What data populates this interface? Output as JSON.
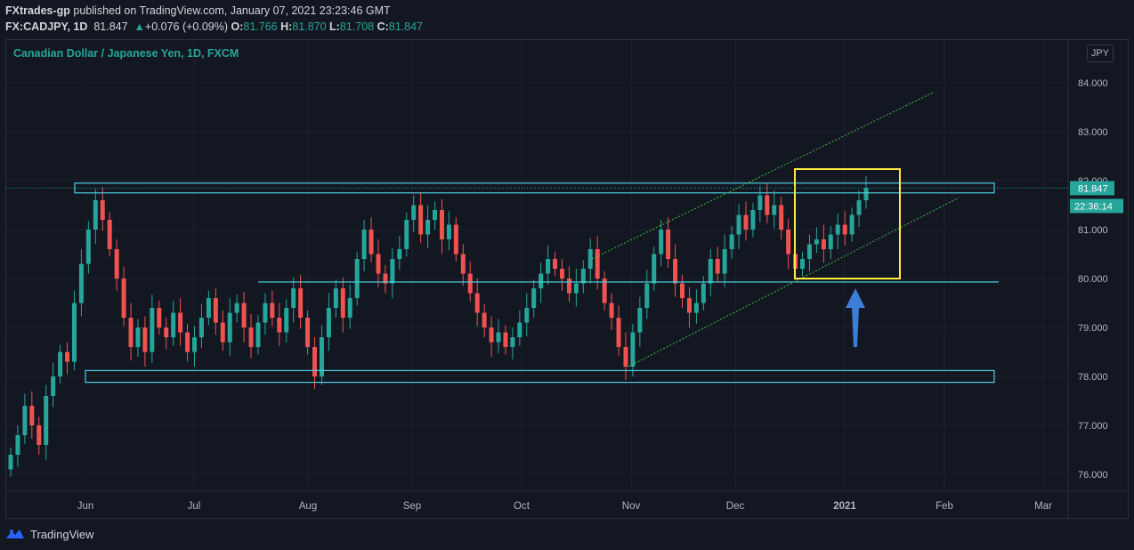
{
  "header": {
    "author": "FXtrades-gp",
    "published_text": "published on TradingView.com, January 07, 2021 23:23:46 GMT",
    "symbol_line": "FX:CADJPY, 1D",
    "last": "81.847",
    "change": "+0.076 (+0.09%)",
    "o_label": "O:",
    "o_val": "81.766",
    "h_label": "H:",
    "h_val": "81.870",
    "l_label": "L:",
    "l_val": "81.708",
    "c_label": "C:",
    "c_val": "81.847"
  },
  "chart_title": "Canadian Dollar / Japanese Yen, 1D, FXCM",
  "currency_badge": "JPY",
  "footer": {
    "brand": "TradingView"
  },
  "chart_data": {
    "type": "candlestick",
    "y_ticks": [
      "84.000",
      "83.000",
      "82.000",
      "81.000",
      "80.000",
      "79.000",
      "78.000",
      "77.000",
      "76.000"
    ],
    "ylim": [
      75.7,
      84.7
    ],
    "x_ticks": [
      "Jun",
      "Jul",
      "Aug",
      "Sep",
      "Oct",
      "Nov",
      "Dec",
      "2021",
      "Feb",
      "Mar"
    ],
    "last_price_label": "81.847",
    "countdown_label": "22:36:14",
    "closes": [
      76.4,
      76.8,
      77.4,
      77.0,
      76.6,
      77.6,
      78.0,
      78.5,
      78.3,
      79.5,
      80.3,
      81.0,
      81.6,
      81.2,
      80.6,
      80.0,
      79.2,
      78.6,
      79.0,
      78.5,
      79.4,
      79.0,
      78.8,
      79.3,
      78.9,
      78.5,
      78.8,
      79.2,
      79.6,
      79.1,
      78.7,
      79.3,
      79.5,
      79.0,
      78.6,
      79.1,
      79.5,
      79.2,
      78.9,
      79.4,
      79.8,
      79.2,
      78.6,
      78.0,
      78.8,
      79.4,
      79.8,
      79.2,
      79.6,
      80.4,
      81.0,
      80.5,
      80.1,
      79.9,
      80.4,
      80.6,
      81.2,
      81.5,
      80.9,
      81.2,
      81.4,
      80.8,
      81.1,
      80.5,
      80.1,
      79.7,
      79.3,
      79.0,
      78.7,
      78.9,
      78.6,
      78.8,
      79.1,
      79.4,
      79.8,
      80.1,
      80.4,
      80.2,
      80.0,
      79.7,
      79.9,
      80.2,
      80.6,
      80.0,
      79.5,
      79.2,
      78.6,
      78.2,
      78.9,
      79.4,
      79.9,
      80.5,
      81.0,
      80.4,
      79.9,
      79.6,
      79.3,
      79.5,
      79.9,
      80.4,
      80.1,
      80.6,
      80.9,
      81.3,
      81.0,
      81.4,
      81.7,
      81.3,
      81.5,
      81.0,
      80.5,
      80.2,
      80.4,
      80.7,
      80.8,
      80.6,
      80.9,
      81.1,
      80.9,
      81.3,
      81.6,
      81.85
    ],
    "annotations": {
      "resistance_zone": [
        81.75,
        81.95
      ],
      "support_zone": [
        77.88,
        78.12
      ],
      "mid_line": 79.93,
      "channel_upper": [
        [
          80.4,
          83.8
        ]
      ],
      "channel_lower": [
        [
          78.2,
          81.65
        ]
      ]
    },
    "grid": true,
    "legend": "none"
  }
}
